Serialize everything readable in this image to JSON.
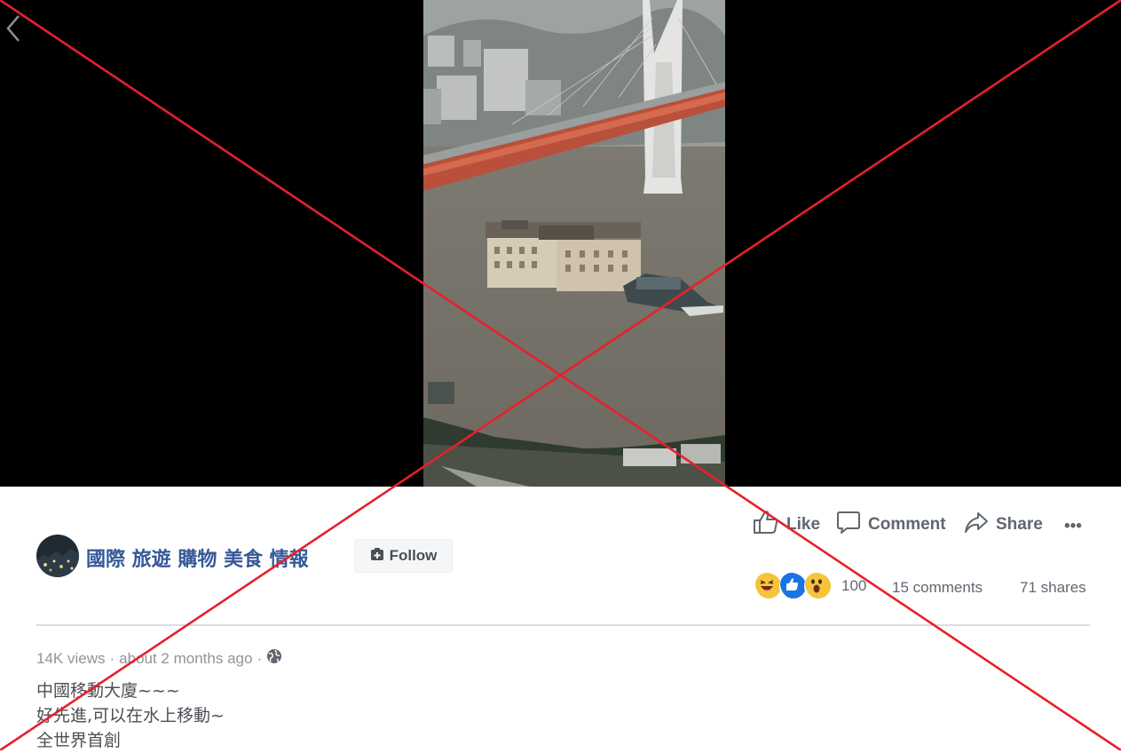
{
  "post": {
    "page_name": "國際 旅遊 購物 美食 情報",
    "follow_label": "Follow",
    "actions": {
      "like": "Like",
      "comment": "Comment",
      "share": "Share",
      "more": "•••"
    },
    "reactions": {
      "icons": [
        "haha-icon",
        "like-icon",
        "wow-icon"
      ],
      "count": "100",
      "comments": "15 comments",
      "shares": "71 shares"
    },
    "meta": {
      "views": "14K views",
      "separator": "·",
      "time": "about 2 months ago",
      "separator2": "·"
    },
    "text_lines": [
      "中國移動大廈~~~",
      "好先進,可以在水上移動~",
      "全世界首創"
    ]
  },
  "colors": {
    "page_name": "#365899",
    "overlay_x": "#e8202a",
    "video_bg": "#000000"
  }
}
